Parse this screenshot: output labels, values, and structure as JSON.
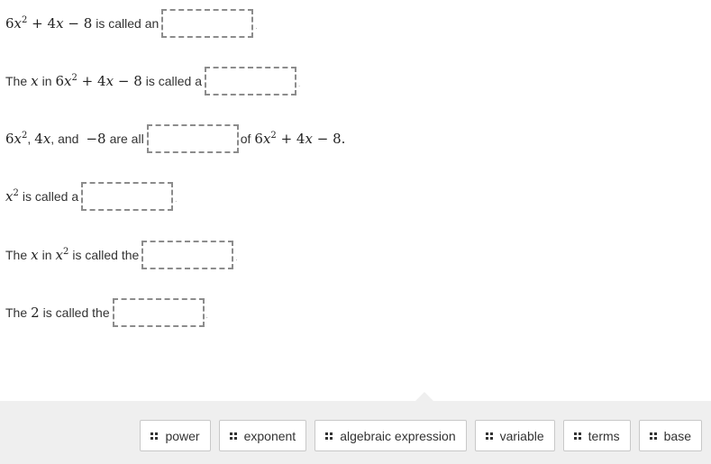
{
  "questions": [
    {
      "pre": "is called an",
      "post": ""
    },
    {
      "pre_a": "The",
      "pre_b": "in",
      "pre_c": "is called a",
      "post": ""
    },
    {
      "sep1": ",",
      "sep2": ", and",
      "pre": "are all",
      "post": "of"
    },
    {
      "pre": "is called a",
      "post": ""
    },
    {
      "pre_a": "The",
      "pre_b": "in",
      "pre_c": "is called the",
      "post": ""
    },
    {
      "pre_a": "The",
      "pre_b": "is called the",
      "post": ""
    }
  ],
  "math": {
    "coef6": "6",
    "x": "x",
    "sq": "2",
    "plus": "+",
    "coef4": "4",
    "minus": "−",
    "eight": "8",
    "neg8": "−8",
    "two": "2",
    "dot": "."
  },
  "word_bank": [
    {
      "label": "power",
      "icon": "drag-handle-icon"
    },
    {
      "label": "exponent",
      "icon": "drag-handle-icon"
    },
    {
      "label": "algebraic expression",
      "icon": "drag-handle-icon"
    },
    {
      "label": "variable",
      "icon": "drag-handle-icon"
    },
    {
      "label": "terms",
      "icon": "drag-handle-icon"
    },
    {
      "label": "base",
      "icon": "drag-handle-icon"
    }
  ]
}
